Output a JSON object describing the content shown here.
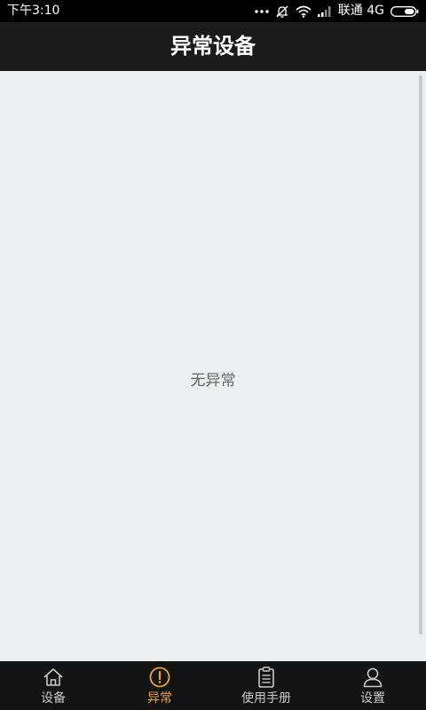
{
  "status_bar": {
    "time": "下午3:10",
    "carrier": "联通 4G",
    "icons": [
      "more-dots-icon",
      "mute-icon",
      "wifi-icon",
      "signal-icon",
      "battery-icon"
    ]
  },
  "header": {
    "title": "异常设备"
  },
  "main": {
    "empty_message": "无异常"
  },
  "bottom_nav": {
    "items": [
      {
        "label": "设备",
        "icon": "home-icon",
        "active": false
      },
      {
        "label": "异常",
        "icon": "alert-circle-icon",
        "active": true
      },
      {
        "label": "使用手册",
        "icon": "clipboard-icon",
        "active": false
      },
      {
        "label": "设置",
        "icon": "user-icon",
        "active": false
      }
    ]
  },
  "colors": {
    "accent": "#e9a23b",
    "nav_background": "#141414",
    "title_background": "#1b1b1b",
    "content_background": "#edeef0"
  }
}
